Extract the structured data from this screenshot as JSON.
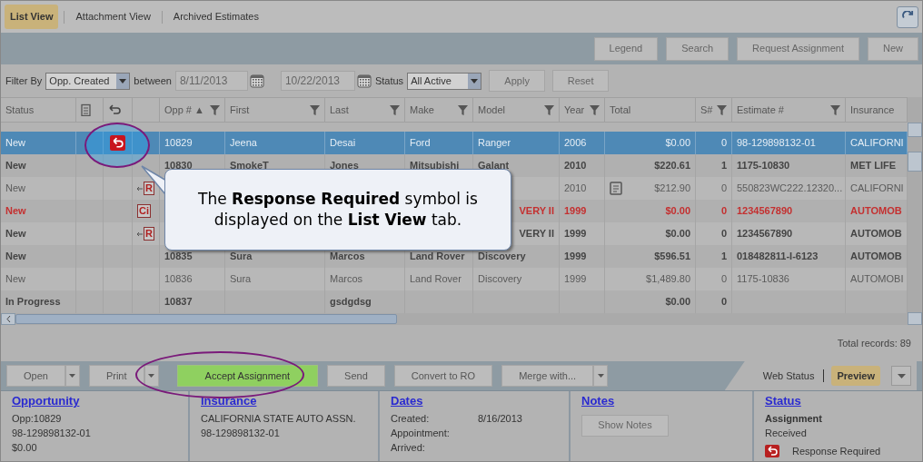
{
  "tabs": [
    {
      "label": "List View",
      "selected": true
    },
    {
      "label": "Attachment View",
      "selected": false
    },
    {
      "label": "Archived Estimates",
      "selected": false
    }
  ],
  "toolbar_buttons": [
    "Legend",
    "Search",
    "Request Assignment",
    "New"
  ],
  "filter": {
    "label": "Filter By",
    "by": "Opp. Created",
    "between": "between",
    "from": "8/11/2013",
    "to": "10/22/2013",
    "status_label": "Status",
    "status": "All Active",
    "apply": "Apply",
    "reset": "Reset"
  },
  "columns": [
    "Status",
    "",
    "",
    "",
    "Opp # ▲",
    "First",
    "Last",
    "Make",
    "Model",
    "Year",
    "Total",
    "S#",
    "Estimate #",
    "Insurance"
  ],
  "rows": [
    {
      "selected": true,
      "kind": "normal",
      "status": "New",
      "reply": true,
      "opp": "10829",
      "first": "Jeena",
      "last": "Desai",
      "make": "Ford",
      "model": "Ranger",
      "year": "2006",
      "total": "$0.00",
      "s": "0",
      "estimate": "98-129898132-01",
      "insurance": "CALIFORNI"
    },
    {
      "selected": false,
      "kind": "bold",
      "status": "New",
      "opp": "10830",
      "first": "SmokeT",
      "last": "Jones",
      "make": "Mitsubishi",
      "model": "Galant",
      "year": "2010",
      "total": "$220.61",
      "s": "1",
      "estimate": "1175-10830",
      "insurance": "MET LIFE"
    },
    {
      "selected": false,
      "kind": "normal",
      "status": "New",
      "flag": {
        "kind": "arrow",
        "text": "R"
      },
      "year": "2010",
      "note": true,
      "total": "$212.90",
      "s": "0",
      "estimate": "550823WC222.12320...",
      "insurance": "CALIFORNI"
    },
    {
      "selected": false,
      "kind": "red",
      "status": "New",
      "flag": {
        "kind": "plain",
        "text": "Ci"
      },
      "model": "VERY II",
      "year": "1999",
      "total": "$0.00",
      "s": "0",
      "estimate": "1234567890",
      "insurance": "AUTOMOB"
    },
    {
      "selected": false,
      "kind": "bold",
      "status": "New",
      "flag": {
        "kind": "arrow",
        "text": "R"
      },
      "model": "VERY II",
      "year": "1999",
      "total": "$0.00",
      "s": "0",
      "estimate": "1234567890",
      "insurance": "AUTOMOB"
    },
    {
      "selected": false,
      "kind": "bold",
      "status": "New",
      "opp": "10835",
      "first": "Sura",
      "last": "Marcos",
      "make": "Land Rover",
      "model": "Discovery",
      "year": "1999",
      "total": "$596.51",
      "s": "1",
      "estimate": "018482811-I-6123",
      "insurance": "AUTOMOB"
    },
    {
      "selected": false,
      "kind": "normal",
      "status": "New",
      "opp": "10836",
      "first": "Sura",
      "last": "Marcos",
      "make": "Land Rover",
      "model": "Discovery",
      "year": "1999",
      "total": "$1,489.80",
      "s": "0",
      "estimate": "1175-10836",
      "insurance": "AUTOMOBI"
    },
    {
      "selected": false,
      "kind": "bold",
      "status": "In Progress",
      "opp": "10837",
      "last": "gsdgdsg",
      "total": "$0.00",
      "s": "0"
    }
  ],
  "callout": "The **Response Required** symbol is displayed on the **List View** tab.",
  "total_records": "Total records: 89",
  "actions": [
    {
      "label": "Open",
      "split": true,
      "kind": "plain"
    },
    {
      "label": "Print",
      "split": true,
      "kind": "plain"
    },
    {
      "label": "Accept Assignment",
      "split": false,
      "kind": "primary"
    },
    {
      "label": "Send",
      "split": false,
      "kind": "plain"
    },
    {
      "label": "Convert to RO",
      "split": false,
      "kind": "plain"
    },
    {
      "label": "Merge with...",
      "split": true,
      "kind": "plain"
    }
  ],
  "view_tabs": [
    {
      "label": "Web Status",
      "selected": false
    },
    {
      "label": "Preview",
      "selected": true
    }
  ],
  "details": {
    "opportunity": {
      "title": "Opportunity",
      "lines": [
        "Opp:10829",
        "98-129898132-01",
        "$0.00"
      ]
    },
    "insurance": {
      "title": "Insurance",
      "lines": [
        "CALIFORNIA STATE AUTO ASSN.",
        "98-129898132-01"
      ]
    },
    "dates": {
      "title": "Dates",
      "rows": [
        {
          "label": "Created:",
          "value": "8/16/2013"
        },
        {
          "label": "Appointment:"
        },
        {
          "label": "Arrived:"
        }
      ]
    },
    "notes": {
      "title": "Notes",
      "button": "Show Notes"
    },
    "status": {
      "title": "Status",
      "heading": "Assignment",
      "value": "Received",
      "flag": "Response Required"
    }
  }
}
